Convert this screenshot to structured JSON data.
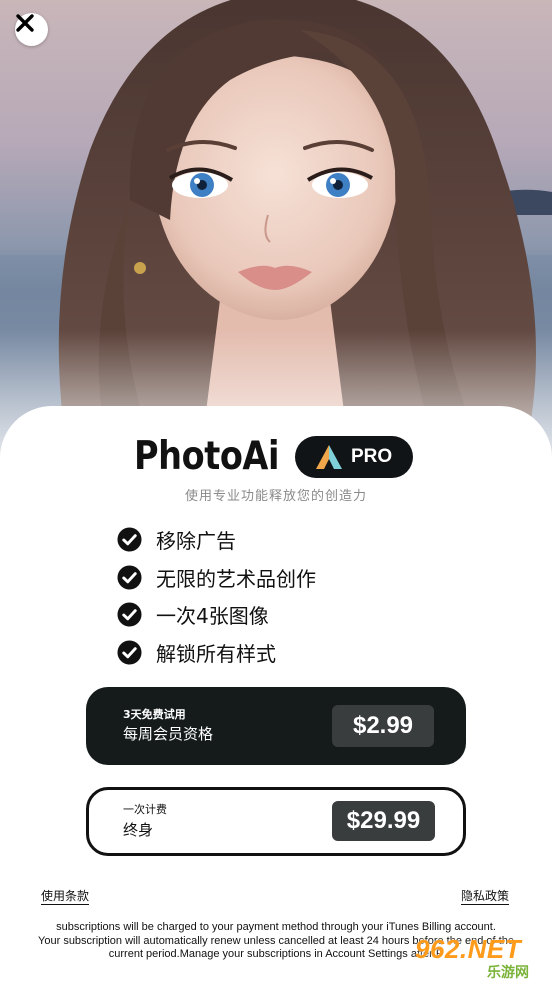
{
  "header": {
    "close_icon": "close-icon"
  },
  "brand": {
    "name": "PhotoAi",
    "badge": "PRO",
    "badge_icon": "triangle-logo-icon",
    "tagline": "使用专业功能释放您的创造力"
  },
  "features": [
    {
      "label": "移除广告",
      "icon": "check-circle-icon"
    },
    {
      "label": "无限的艺术品创作",
      "icon": "check-circle-icon"
    },
    {
      "label": "一次4张图像",
      "icon": "check-circle-icon"
    },
    {
      "label": "解锁所有样式",
      "icon": "check-circle-icon"
    }
  ],
  "plans": [
    {
      "trial": "3天免费试用",
      "name": "每周会员资格",
      "price": "$2.99",
      "selected": true
    },
    {
      "trial": "一次计费",
      "name": "终身",
      "price": "$29.99",
      "selected": false
    }
  ],
  "footer": {
    "terms": "使用条款",
    "privacy": "隐私政策",
    "legal_lines": [
      "subscriptions will be charged to your payment method through your iTunes Billing account.",
      "Your subscription will automatically renew unless cancelled at least 24 hours before the end of the",
      "current period.Manage your subscriptions in Account Settings after P"
    ]
  },
  "watermark": {
    "top": "962.NET",
    "bottom": "乐游网"
  },
  "colors": {
    "dark": "#151b1b",
    "price_bg": "#3a3d3e",
    "accent_text": "#8a8a8a"
  }
}
